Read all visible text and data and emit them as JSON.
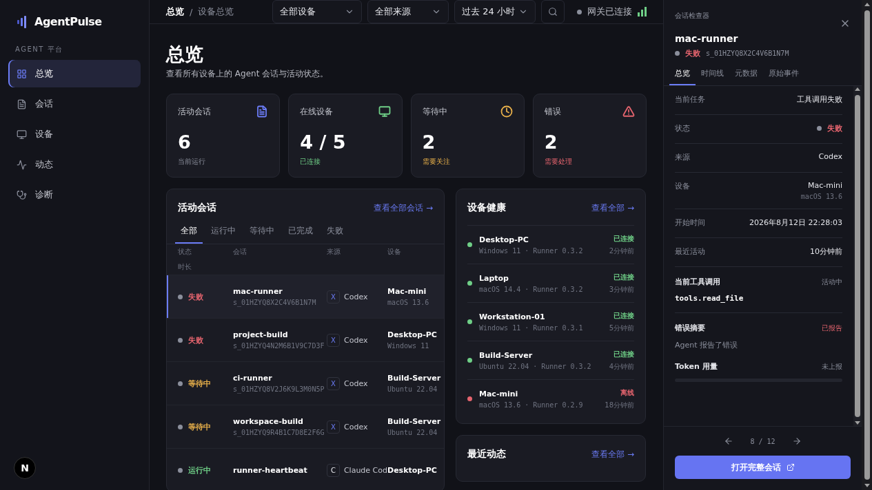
{
  "sidebar": {
    "logo": "AgentPulse",
    "section": "AGENT 平台",
    "items": [
      {
        "label": "总览",
        "selected": true
      },
      {
        "label": "会话",
        "selected": false
      },
      {
        "label": "设备",
        "selected": false
      },
      {
        "label": "动态",
        "selected": false
      },
      {
        "label": "诊断",
        "selected": false
      }
    ],
    "avatar": "N"
  },
  "topbar": {
    "breadcrumb": [
      "总览",
      "设备总览"
    ],
    "separator": "/",
    "filters": [
      "全部设备",
      "全部来源",
      "过去 24 小时"
    ],
    "gateway": {
      "label": "网关已连接",
      "connected": true
    }
  },
  "page": {
    "title": "总览",
    "subtitle": "查看所有设备上的 Agent 会话与活动状态。"
  },
  "stats": [
    {
      "label": "活动会话",
      "value": "6",
      "note": "当前运行",
      "color": "#6b7cf6"
    },
    {
      "label": "在线设备",
      "value": "4 / 5",
      "note": "已连接",
      "color": "#6fcf87"
    },
    {
      "label": "等待中",
      "value": "2",
      "note": "需要关注",
      "color": "#e8b04a"
    },
    {
      "label": "错误",
      "value": "2",
      "note": "需要处理",
      "color": "#e5646e"
    }
  ],
  "sessions": {
    "title": "活动会话",
    "link": "查看全部会话 →",
    "tabs": [
      {
        "label": "全部",
        "selected": true
      },
      {
        "label": "运行中",
        "selected": false
      },
      {
        "label": "等待中",
        "selected": false
      },
      {
        "label": "已完成",
        "selected": false
      },
      {
        "label": "失败",
        "selected": false
      }
    ],
    "columns": [
      "状态",
      "会话",
      "来源",
      "设备",
      "时长"
    ],
    "rows": [
      {
        "status": "失败",
        "color": "#e5646e",
        "name": "mac-runner",
        "id": "s_01HZYQ8X2C4V6B1N7M",
        "source_icon": "X",
        "source": "Codex",
        "device": "Mac-mini",
        "os": "macOS 13.6",
        "selected": true
      },
      {
        "status": "失败",
        "color": "#e5646e",
        "name": "project-build",
        "id": "s_01HZYQ4N2M6B1V9C7D3F",
        "source_icon": "X",
        "source": "Codex",
        "device": "Desktop-PC",
        "os": "Windows 11",
        "selected": false
      },
      {
        "status": "等待中",
        "color": "#e8b04a",
        "name": "ci-runner",
        "id": "s_01HZYQ8V2J6K9L3M0N5P",
        "source_icon": "X",
        "source": "Codex",
        "device": "Build-Server",
        "os": "Ubuntu 22.04",
        "selected": false
      },
      {
        "status": "等待中",
        "color": "#e8b04a",
        "name": "workspace-build",
        "id": "s_01HZYQ9R4B1C7D8E2F6G",
        "source_icon": "X",
        "source": "Codex",
        "device": "Build-Server",
        "os": "Ubuntu 22.04",
        "selected": false
      },
      {
        "status": "运行中",
        "color": "#6fcf87",
        "name": "runner-heartbeat",
        "source_icon": "C",
        "source": "Claude Cod",
        "device": "Desktop-PC",
        "selected": false
      }
    ]
  },
  "devices": {
    "title": "设备健康",
    "link": "查看全部 →",
    "items": [
      {
        "name": "Desktop-PC",
        "meta": "Windows 11 · Runner 0.3.2",
        "status": "已连接",
        "time": "2分钟前",
        "online": true
      },
      {
        "name": "Laptop",
        "meta": "macOS 14.4 · Runner 0.3.2",
        "status": "已连接",
        "time": "3分钟前",
        "online": true
      },
      {
        "name": "Workstation-01",
        "meta": "Windows 11 · Runner 0.3.1",
        "status": "已连接",
        "time": "5分钟前",
        "online": true
      },
      {
        "name": "Build-Server",
        "meta": "Ubuntu 22.04 · Runner 0.3.2",
        "status": "已连接",
        "time": "4分钟前",
        "online": true
      },
      {
        "name": "Mac-mini",
        "meta": "macOS 13.6 · Runner 0.2.9",
        "status": "离线",
        "time": "18分钟前",
        "online": false
      }
    ]
  },
  "activity": {
    "title": "最近动态",
    "link": "查看全部 →"
  },
  "inspector": {
    "caption": "会话检查器",
    "name": "mac-runner",
    "status": "失败",
    "color": "#e5646e",
    "id": "s_01HZYQ8X2C4V6B1N7M",
    "tabs": [
      {
        "label": "总览",
        "selected": true
      },
      {
        "label": "时间线",
        "selected": false
      },
      {
        "label": "元数据",
        "selected": false
      },
      {
        "label": "原始事件",
        "selected": false
      }
    ],
    "fields": [
      {
        "label": "当前任务",
        "value": "工具调用失败",
        "kind": "text"
      },
      {
        "label": "状态",
        "value": "失败",
        "kind": "status",
        "color": "#e5646e"
      },
      {
        "label": "来源",
        "value": "Codex",
        "kind": "text"
      },
      {
        "label": "设备",
        "value": "Mac-mini",
        "sub": "macOS 13.6",
        "kind": "text"
      },
      {
        "label": "开始时间",
        "value": "2026年8月12日 22:28:03",
        "kind": "text"
      },
      {
        "label": "最近活动",
        "value": "10分钟前",
        "kind": "text"
      }
    ],
    "tool": {
      "label": "当前工具调用",
      "badge": "活动中",
      "value": "tools.read_file"
    },
    "error": {
      "label": "错误摘要",
      "badge": "已报告",
      "text": "Agent 报告了错误"
    },
    "tokens": {
      "label": "Token 用量",
      "badge": "未上报"
    },
    "pager": "8 / 12",
    "button": "打开完整会话"
  }
}
